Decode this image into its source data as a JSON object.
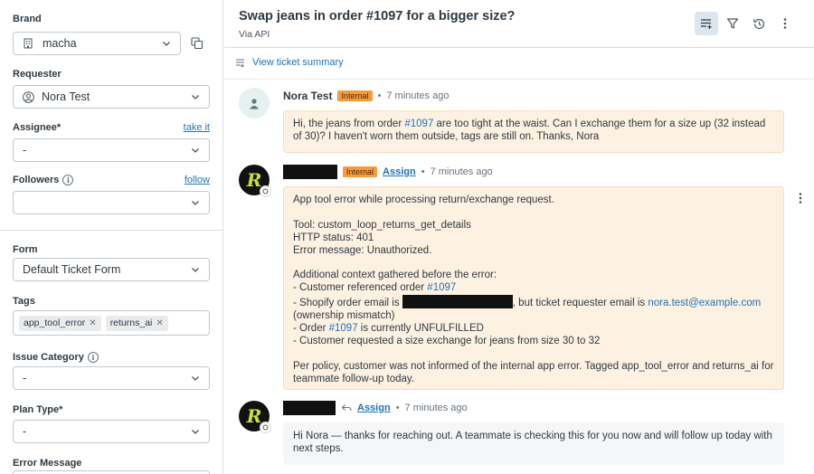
{
  "sidebar": {
    "brand": {
      "label": "Brand",
      "value": "macha"
    },
    "requester": {
      "label": "Requester",
      "value": "Nora Test"
    },
    "assignee": {
      "label": "Assignee*",
      "action": "take it",
      "value": "-"
    },
    "followers": {
      "label": "Followers",
      "action": "follow",
      "value": ""
    },
    "form": {
      "label": "Form",
      "value": "Default Ticket Form"
    },
    "tags": {
      "label": "Tags",
      "items": [
        "app_tool_error",
        "returns_ai"
      ]
    },
    "issue_category": {
      "label": "Issue Category",
      "value": "-"
    },
    "plan_type": {
      "label": "Plan Type*",
      "value": "-"
    },
    "error_message": {
      "label": "Error Message"
    }
  },
  "header": {
    "title": "Swap jeans in order #1097 for a bigger size?",
    "channel": "Via API"
  },
  "summary_link": "View ticket summary",
  "messages": [
    {
      "author": "Nora Test",
      "badge": "Internal",
      "time": "7 minutes ago",
      "body_parts": [
        "Hi, the jeans from order ",
        "#1097",
        " are too tight at the waist. Can I exchange them for a size up (32 instead of 30)? I haven't worn them outside, tags are still on. Thanks, Nora"
      ]
    },
    {
      "badge": "Internal",
      "assign": "Assign",
      "time": "7 minutes ago",
      "lines": {
        "l1": "App tool error while processing return/exchange request.",
        "l2": "Tool: custom_loop_returns_get_details",
        "l3": "HTTP status: 401",
        "l4": "Error message: Unauthorized.",
        "l5": "Additional context gathered before the error:",
        "l6a": "- Customer referenced order ",
        "l6b": "#1097",
        "l7a": "- Shopify order email is ",
        "l7b": ", but ticket requester email is ",
        "l7c": "nora.test@example.com",
        "l8": "(ownership mismatch)",
        "l9a": "- Order ",
        "l9b": "#1097",
        "l9c": " is currently UNFULFILLED",
        "l10": "- Customer requested a size exchange for jeans from size 30 to 32",
        "l11": "Per policy, customer was not informed of the internal app error. Tagged app_tool_error and returns_ai for teammate follow-up today."
      }
    },
    {
      "assign": "Assign",
      "time": "7 minutes ago",
      "body": "Hi Nora — thanks for reaching out. A teammate is checking this for you now and will follow up today with next steps."
    }
  ],
  "colors": {
    "link": "#1f73b7",
    "internal_badge": "#f79a3e",
    "internal_bg": "#fdf1e2",
    "active_button_bg": "#dde6ee"
  }
}
